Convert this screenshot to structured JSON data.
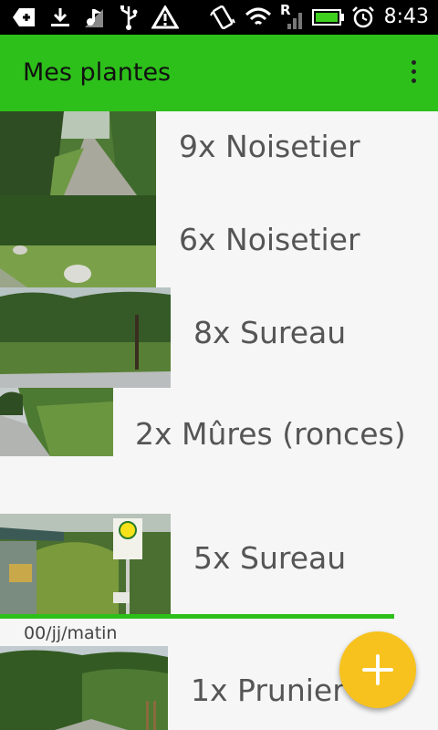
{
  "status_bar": {
    "time": "8:43",
    "signal_letter": "R",
    "icons": [
      "add-notification-icon",
      "download-icon",
      "music-icon",
      "usb-icon",
      "warning-icon",
      "vibrate-icon",
      "wifi-icon",
      "signal-icon",
      "battery-icon",
      "alarm-icon"
    ]
  },
  "app_bar": {
    "title": "Mes plantes",
    "overflow_icon": "more-vert-icon"
  },
  "plants": [
    {
      "label": "9x Noisetier"
    },
    {
      "label": "6x Noisetier"
    },
    {
      "label": "8x Sureau"
    },
    {
      "label": "2x Mûres (ronces)"
    },
    {
      "label": "5x Sureau"
    },
    {
      "label": "1x Prunier"
    }
  ],
  "section": {
    "date_label": "00/jj/matin"
  },
  "fab": {
    "icon": "add-icon"
  },
  "colors": {
    "accent": "#2dc01a",
    "fab": "#f7c21d",
    "text": "#555555"
  }
}
